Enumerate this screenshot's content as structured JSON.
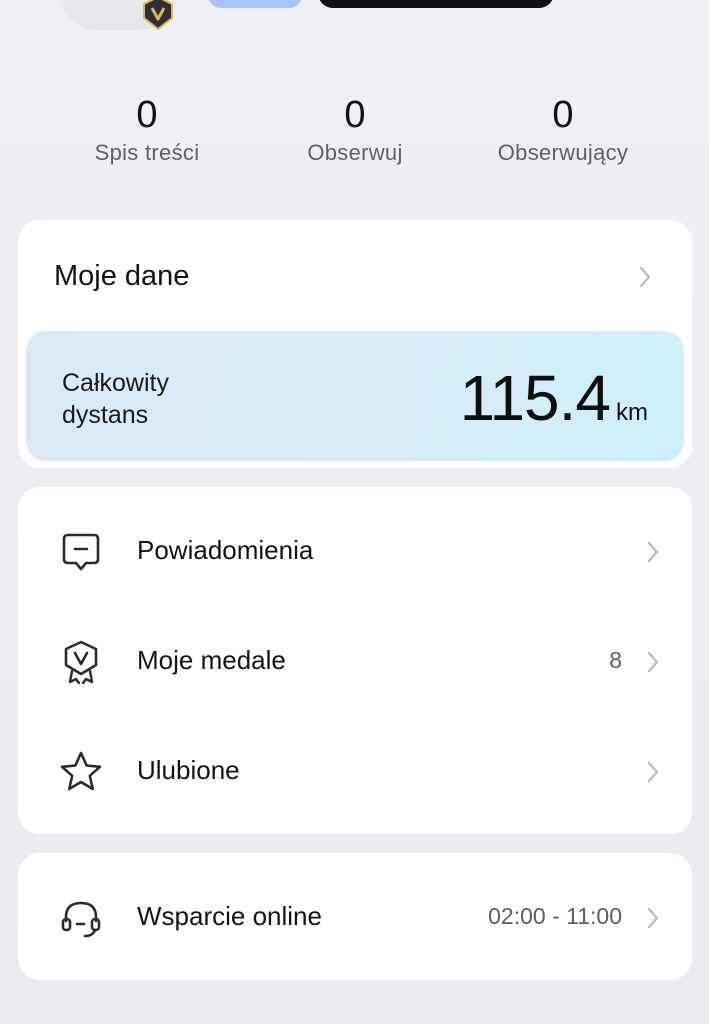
{
  "header": {
    "badge_icon": "v-shield-badge-icon"
  },
  "stats": [
    {
      "value": "0",
      "label": "Spis treści"
    },
    {
      "value": "0",
      "label": "Obserwuj"
    },
    {
      "value": "0",
      "label": "Obserwujący"
    }
  ],
  "my_data": {
    "title": "Moje dane",
    "distance_label": "Całkowity dystans",
    "distance_value": "115.4",
    "distance_unit": "km"
  },
  "menu": [
    {
      "label": "Powiadomienia",
      "value": "",
      "icon": "message-icon"
    },
    {
      "label": "Moje medale",
      "value": "8",
      "icon": "medal-icon"
    },
    {
      "label": "Ulubione",
      "value": "",
      "icon": "star-icon"
    }
  ],
  "support": {
    "label": "Wsparcie online",
    "hours": "02:00 - 11:00",
    "icon": "headset-icon"
  },
  "colors": {
    "background": "#eef0f5",
    "card": "#ffffff",
    "distance_bg": "#d8ecf7",
    "badge_gold": "#e3b54b",
    "badge_dark": "#2b2f3a"
  }
}
